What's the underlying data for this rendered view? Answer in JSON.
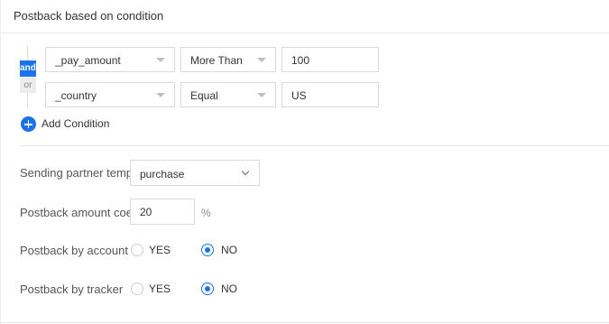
{
  "header": {
    "title": "Postback based on condition"
  },
  "logic": {
    "and_label": "and",
    "or_label": "or",
    "active": "and"
  },
  "conditions": [
    {
      "field": "_pay_amount",
      "operator": "More Than",
      "value": "100"
    },
    {
      "field": "_country",
      "operator": "Equal",
      "value": "US"
    }
  ],
  "add_condition": {
    "label": "Add Condition"
  },
  "settings": {
    "partner_template": {
      "label": "Sending partner template",
      "value": "purchase"
    },
    "amount": {
      "label": "Postback amount coefficient",
      "value": "20",
      "unit": "%"
    },
    "by_account": {
      "label": "Postback by account",
      "yes_label": "YES",
      "no_label": "NO",
      "selected": "NO"
    },
    "by_tracker": {
      "label": "Postback by tracker",
      "yes_label": "YES",
      "no_label": "NO",
      "selected": "NO"
    }
  },
  "colors": {
    "accent": "#1a73e8",
    "border": "#d9d9d9",
    "divider": "#e8e8e8"
  }
}
